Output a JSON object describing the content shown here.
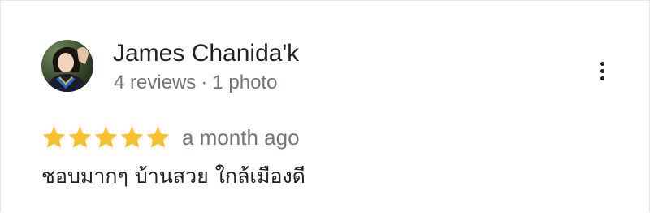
{
  "review": {
    "reviewer_name": "James Chanida'k",
    "reviews_count": "4 reviews",
    "separator": "·",
    "photos_count": "1 photo",
    "rating": 5,
    "max_rating": 5,
    "time": "a month ago",
    "text": "ชอบมากๆ บ้านสวย ใกล้เมืองดี",
    "avatar_icon": "user-avatar",
    "more_icon": "more-vert-icon",
    "star_icon": "star-icon"
  },
  "colors": {
    "star": "#fbc02d",
    "secondary_text": "#70757a",
    "primary_text": "#202124"
  }
}
